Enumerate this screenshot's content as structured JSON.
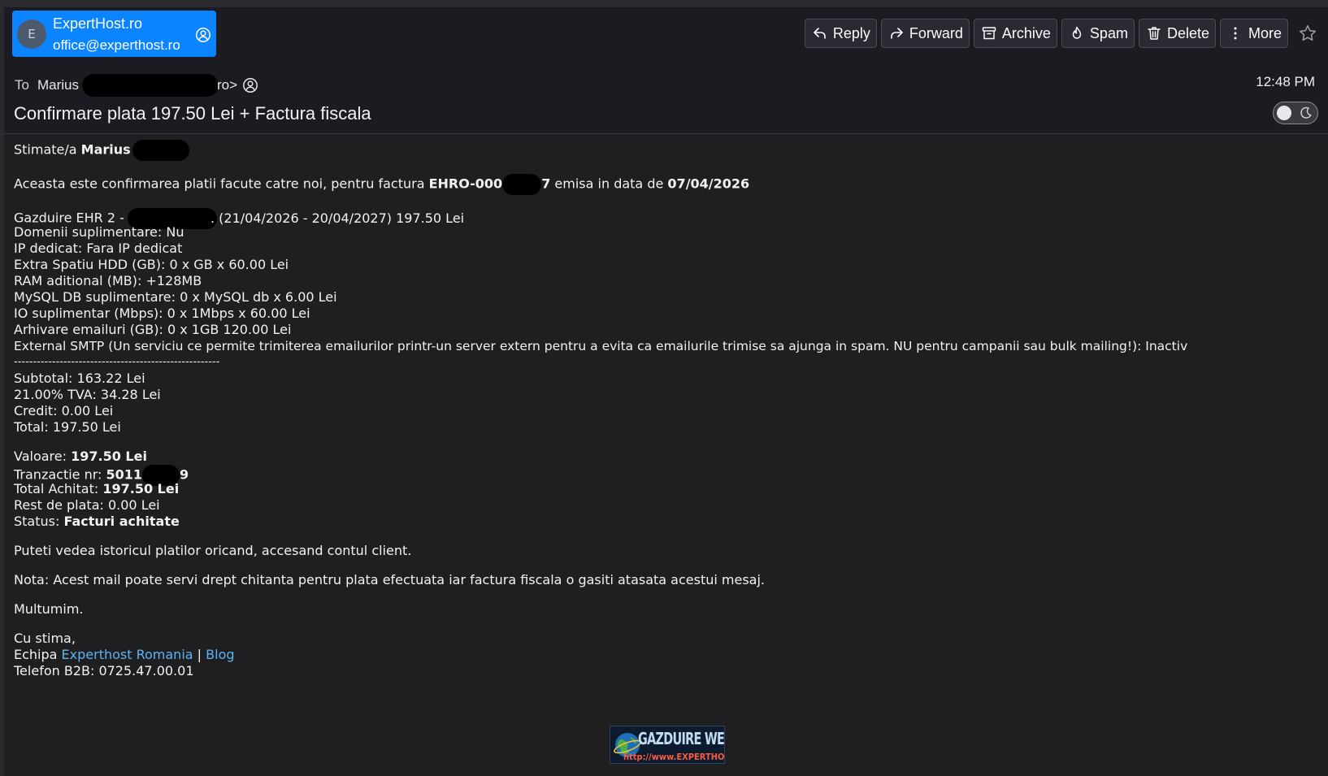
{
  "sender": {
    "avatar_letter": "E",
    "name": "ExpertHost.ro",
    "email": "office@experthost.ro"
  },
  "toolbar": {
    "reply": "Reply",
    "forward": "Forward",
    "archive": "Archive",
    "spam": "Spam",
    "delete": "Delete",
    "more": "More"
  },
  "recipient": {
    "to_label": "To",
    "name_visible": "Marius",
    "tail": "ro>"
  },
  "time": "12:48 PM",
  "subject": "Confirmare plata 197.50 Lei + Factura fiscala",
  "body": {
    "greeting_prefix": "Stimate/a",
    "greeting_name": "Marius",
    "confirm_text": "Aceasta este confirmarea platii facute catre noi, pentru factura",
    "invoice_prefix": "EHRO-000",
    "invoice_suffix": "7",
    "issued_text": "emisa in data de",
    "issued_date": "07/04/2026",
    "items": {
      "hosting_prefix": "Gazduire EHR 2 -",
      "hosting_rest": ". (21/04/2026 - 20/04/2027) 197.50 Lei",
      "lines": [
        "Domenii suplimentare: Nu",
        "IP dedicat: Fara IP dedicat",
        "Extra Spatiu HDD (GB): 0 x GB x 60.00 Lei",
        "RAM aditional (MB): +128MB",
        "MySQL DB suplimentare: 0 x MySQL db x 6.00 Lei",
        "IO suplimentar (Mbps): 0 x 1Mbps x 60.00 Lei",
        "Arhivare emailuri (GB): 0 x 1GB 120.00 Lei",
        "External SMTP (Un serviciu ce permite trimiterea emailurilor printr-un server extern pentru a evita ca emailurile trimise sa ajunga in spam. NU pentru campanii sau bulk mailing!): Inactiv",
        "------------------------------------------------------",
        "Subtotal: 163.22 Lei",
        "21.00% TVA: 34.28 Lei",
        "Credit: 0.00 Lei",
        "Total: 197.50 Lei"
      ]
    },
    "payment": {
      "value_label": "Valoare:",
      "value": "197.50 Lei",
      "tx_label": "Tranzactie nr:",
      "tx_prefix": "5011",
      "tx_suffix": "9",
      "paid_label": "Total Achitat:",
      "paid": "197.50 Lei",
      "rest": "Rest de plata: 0.00 Lei",
      "status_label": "Status:",
      "status": "Facturi achitate"
    },
    "history": "Puteti vedea istoricul platilor oricand, accesand contul client.",
    "note": "Nota: Acest mail poate servi drept chitanta pentru plata efectuata iar factura fiscala o gasiti atasata acestui mesaj.",
    "thanks": "Multumim.",
    "signoff": "Cu stima,",
    "team_prefix": "Echipa",
    "team_link": "Experthost Romania",
    "separator": "|",
    "blog_link": "Blog",
    "phone": "Telefon B2B: 0725.47.00.01"
  },
  "logo": {
    "line1": "GAZDUIRE WEB",
    "line2": "http://www.EXPERTHOST.RO"
  },
  "colors": {
    "accent": "#0a84ff",
    "link": "#5ab4f5",
    "background": "#1f1f22"
  }
}
